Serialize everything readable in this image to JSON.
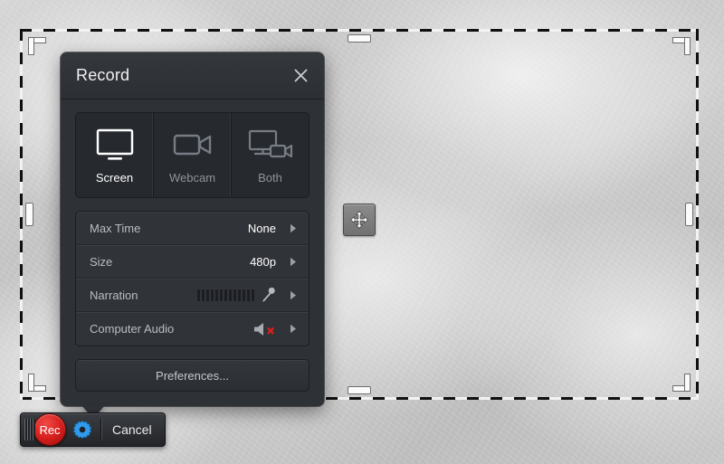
{
  "panel": {
    "title": "Record",
    "close_icon": "close-icon",
    "modes": [
      {
        "label": "Screen",
        "icon": "monitor-icon",
        "selected": true
      },
      {
        "label": "Webcam",
        "icon": "video-camera-icon",
        "selected": false
      },
      {
        "label": "Both",
        "icon": "monitor-and-camera-icon",
        "selected": false
      }
    ],
    "rows": [
      {
        "label": "Max Time",
        "value": "None",
        "kind": "value",
        "arrow_icon": "chevron-right-icon"
      },
      {
        "label": "Size",
        "value": "480p",
        "kind": "value",
        "arrow_icon": "chevron-right-icon"
      },
      {
        "label": "Narration",
        "value": "",
        "kind": "meter",
        "meter_icon": "microphone-icon",
        "meter_bars": 13,
        "arrow_icon": "chevron-right-icon"
      },
      {
        "label": "Computer Audio",
        "value": "",
        "kind": "muted",
        "muted_icon": "speaker-muted-icon",
        "arrow_icon": "chevron-right-icon"
      }
    ],
    "preferences_label": "Preferences..."
  },
  "toolbar": {
    "grip_icon": "drag-grip-icon",
    "record_label": "Rec",
    "settings_icon": "gear-icon",
    "cancel_label": "Cancel"
  },
  "selection": {
    "move_handle_icon": "move-four-arrows-icon"
  },
  "colors": {
    "record_red": "#d71f1c",
    "gear_blue": "#2f9bea",
    "mute_red": "#d8201c",
    "panel_bg": "#2e3136",
    "accent_white": "#ffffff"
  }
}
